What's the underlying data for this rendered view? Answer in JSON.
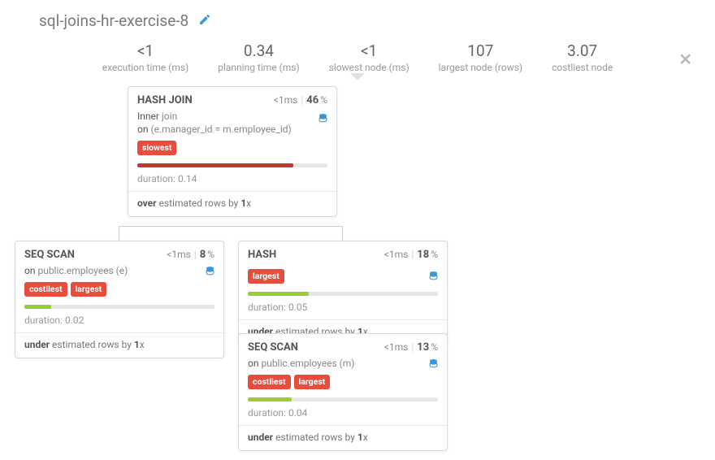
{
  "header": {
    "title": "sql-joins-hr-exercise-8"
  },
  "stats": {
    "exec_time": {
      "value": "<1",
      "label": "execution time (ms)"
    },
    "plan_time": {
      "value": "0.34",
      "label": "planning time (ms)"
    },
    "slowest_node": {
      "value": "<1",
      "label": "slowest node (ms)"
    },
    "largest_node": {
      "value": "107",
      "label": "largest node (rows)"
    },
    "costliest_node": {
      "value": "3.07",
      "label": "costliest node"
    }
  },
  "nodes": {
    "hashjoin": {
      "title": "HASH JOIN",
      "time": "<1ms",
      "pct": "46",
      "desc_pre": "Inner",
      "desc_mid": " join",
      "desc_on_lbl": "on",
      "desc_on": " (e.manager_id = m.employee_id)",
      "tags": [
        "slowest"
      ],
      "bar_color": "red",
      "bar_width": "82%",
      "duration_label": "duration: ",
      "duration": "0.14",
      "est_dir": "over",
      "est_mid": " estimated rows by ",
      "est_factor": "1",
      "est_suffix": "x"
    },
    "seqscan1": {
      "title": "SEQ SCAN",
      "time": "<1ms",
      "pct": "8",
      "desc_on_lbl": "on",
      "desc_on": " public.employees (e)",
      "tags": [
        "costliest",
        "largest"
      ],
      "bar_color": "green",
      "bar_width": "14%",
      "duration_label": "duration: ",
      "duration": "0.02",
      "est_dir": "under",
      "est_mid": " estimated rows by ",
      "est_factor": "1",
      "est_suffix": "x"
    },
    "hash": {
      "title": "HASH",
      "time": "<1ms",
      "pct": "18",
      "tags": [
        "largest"
      ],
      "bar_color": "green",
      "bar_width": "32%",
      "duration_label": "duration: ",
      "duration": "0.05",
      "est_dir": "under",
      "est_mid": " estimated rows by ",
      "est_factor": "1",
      "est_suffix": "x"
    },
    "seqscan2": {
      "title": "SEQ SCAN",
      "time": "<1ms",
      "pct": "13",
      "desc_on_lbl": "on",
      "desc_on": " public.employees (m)",
      "tags": [
        "costliest",
        "largest"
      ],
      "bar_color": "green",
      "bar_width": "23%",
      "duration_label": "duration: ",
      "duration": "0.04",
      "est_dir": "under",
      "est_mid": " estimated rows by ",
      "est_factor": "1",
      "est_suffix": "x"
    }
  }
}
